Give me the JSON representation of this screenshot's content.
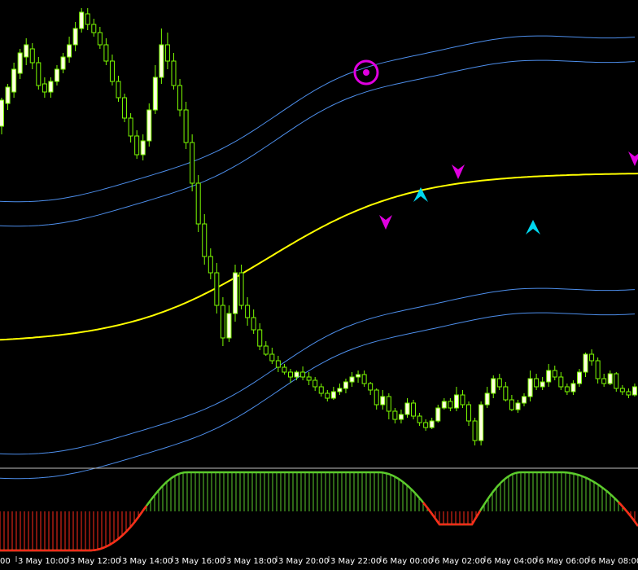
{
  "colors": {
    "background": "#000000",
    "candle": "#7CFC00",
    "candle_bull_body": "#FFFFE0",
    "ma_line": "#FFFF00",
    "band": "#4D8EEB",
    "osc_up": "#5CCB2C",
    "osc_down": "#FF2A1A",
    "osc_transition": "#FFD200",
    "sell_arrow": "#E000E0",
    "buy_arrow": "#00D7EF",
    "target_marker": "#E000E0",
    "separator": "#C0C0C0",
    "text": "#FFFFFF"
  },
  "chart_data": {
    "type": "candlestick",
    "x_labels": [
      "3 May 10:00",
      "3 May 12:00",
      "3 May 14:00",
      "3 May 16:00",
      "3 May 18:00",
      "3 May 20:00",
      "3 May 22:00",
      "6 May 00:00",
      "6 May 02:00",
      "6 May 04:00",
      "6 May 06:00",
      "6 May 08:00"
    ],
    "candles": [
      [
        420,
        452,
        410,
        455
      ],
      [
        448,
        468,
        440,
        472
      ],
      [
        462,
        490,
        455,
        498
      ],
      [
        485,
        510,
        478,
        515
      ],
      [
        505,
        520,
        495,
        528
      ],
      [
        515,
        498,
        490,
        522
      ],
      [
        498,
        470,
        465,
        505
      ],
      [
        472,
        462,
        455,
        480
      ],
      [
        462,
        475,
        455,
        480
      ],
      [
        475,
        490,
        470,
        495
      ],
      [
        490,
        505,
        485,
        510
      ],
      [
        505,
        520,
        498,
        530
      ],
      [
        520,
        540,
        512,
        548
      ],
      [
        540,
        560,
        535,
        565
      ],
      [
        558,
        545,
        538,
        565
      ],
      [
        545,
        535,
        530,
        552
      ],
      [
        535,
        520,
        515,
        542
      ],
      [
        520,
        500,
        495,
        528
      ],
      [
        500,
        475,
        470,
        508
      ],
      [
        475,
        455,
        450,
        482
      ],
      [
        455,
        430,
        425,
        460
      ],
      [
        430,
        408,
        400,
        436
      ],
      [
        408,
        385,
        380,
        415
      ],
      [
        385,
        402,
        378,
        410
      ],
      [
        402,
        440,
        395,
        448
      ],
      [
        440,
        480,
        435,
        495
      ],
      [
        480,
        520,
        472,
        540
      ],
      [
        520,
        500,
        490,
        535
      ],
      [
        500,
        470,
        465,
        510
      ],
      [
        470,
        440,
        432,
        478
      ],
      [
        440,
        400,
        392,
        450
      ],
      [
        400,
        350,
        340,
        410
      ],
      [
        350,
        300,
        290,
        360
      ],
      [
        300,
        260,
        250,
        312
      ],
      [
        260,
        240,
        232,
        270
      ],
      [
        240,
        200,
        190,
        252
      ],
      [
        200,
        160,
        150,
        210
      ],
      [
        160,
        190,
        155,
        200
      ],
      [
        190,
        240,
        180,
        250
      ],
      [
        240,
        200,
        195,
        250
      ],
      [
        200,
        185,
        175,
        210
      ],
      [
        185,
        170,
        165,
        195
      ],
      [
        170,
        150,
        145,
        178
      ],
      [
        150,
        140,
        138,
        156
      ],
      [
        140,
        132,
        128,
        148
      ],
      [
        132,
        124,
        118,
        138
      ],
      [
        124,
        118,
        115,
        128
      ],
      [
        118,
        112,
        105,
        122
      ],
      [
        112,
        118,
        108,
        120
      ],
      [
        118,
        112,
        108,
        125
      ],
      [
        112,
        108,
        102,
        118
      ],
      [
        108,
        100,
        95,
        112
      ],
      [
        100,
        92,
        88,
        104
      ],
      [
        92,
        86,
        82,
        96
      ],
      [
        86,
        94,
        84,
        100
      ],
      [
        94,
        98,
        90,
        104
      ],
      [
        98,
        106,
        92,
        110
      ],
      [
        106,
        112,
        100,
        118
      ],
      [
        112,
        115,
        105,
        120
      ],
      [
        115,
        104,
        100,
        120
      ],
      [
        104,
        96,
        90,
        106
      ],
      [
        96,
        78,
        72,
        98
      ],
      [
        78,
        88,
        72,
        96
      ],
      [
        88,
        70,
        60,
        92
      ],
      [
        70,
        60,
        55,
        74
      ],
      [
        60,
        66,
        55,
        72
      ],
      [
        66,
        80,
        62,
        86
      ],
      [
        80,
        64,
        60,
        84
      ],
      [
        64,
        56,
        52,
        68
      ],
      [
        56,
        50,
        46,
        60
      ],
      [
        50,
        58,
        48,
        62
      ],
      [
        58,
        74,
        56,
        78
      ],
      [
        74,
        82,
        72,
        86
      ],
      [
        82,
        74,
        70,
        86
      ],
      [
        74,
        90,
        70,
        100
      ],
      [
        90,
        78,
        74,
        96
      ],
      [
        78,
        58,
        52,
        82
      ],
      [
        58,
        34,
        28,
        62
      ],
      [
        34,
        78,
        28,
        82
      ],
      [
        78,
        92,
        74,
        100
      ],
      [
        92,
        110,
        86,
        114
      ],
      [
        110,
        100,
        96,
        116
      ],
      [
        100,
        84,
        82,
        106
      ],
      [
        84,
        72,
        70,
        90
      ],
      [
        72,
        80,
        68,
        84
      ],
      [
        80,
        88,
        76,
        92
      ],
      [
        88,
        110,
        82,
        120
      ],
      [
        110,
        100,
        96,
        116
      ],
      [
        100,
        106,
        96,
        112
      ],
      [
        106,
        120,
        100,
        128
      ],
      [
        120,
        112,
        108,
        126
      ],
      [
        112,
        100,
        96,
        118
      ],
      [
        100,
        94,
        90,
        104
      ],
      [
        94,
        104,
        90,
        108
      ],
      [
        104,
        118,
        100,
        122
      ],
      [
        118,
        140,
        112,
        142
      ],
      [
        140,
        132,
        126,
        146
      ],
      [
        132,
        110,
        104,
        136
      ],
      [
        110,
        104,
        100,
        116
      ],
      [
        104,
        116,
        102,
        120
      ],
      [
        116,
        98,
        94,
        118
      ],
      [
        98,
        94,
        90,
        102
      ],
      [
        94,
        90,
        86,
        98
      ],
      [
        90,
        100,
        88,
        104
      ]
    ],
    "x_ticks": [
      0,
      6,
      12,
      18,
      24,
      30,
      36,
      42,
      48,
      54,
      60,
      66
    ]
  },
  "time_axis": {
    "labels": [
      "00",
      "3 May 10:00",
      "3 May 12:00",
      "3 May 14:00",
      "3 May 16:00",
      "3 May 18:00",
      "3 May 20:00",
      "3 May 22:00",
      "6 May 00:00",
      "6 May 02:00",
      "6 May 04:00",
      "6 May 06:00",
      "6 May 08:00"
    ]
  }
}
